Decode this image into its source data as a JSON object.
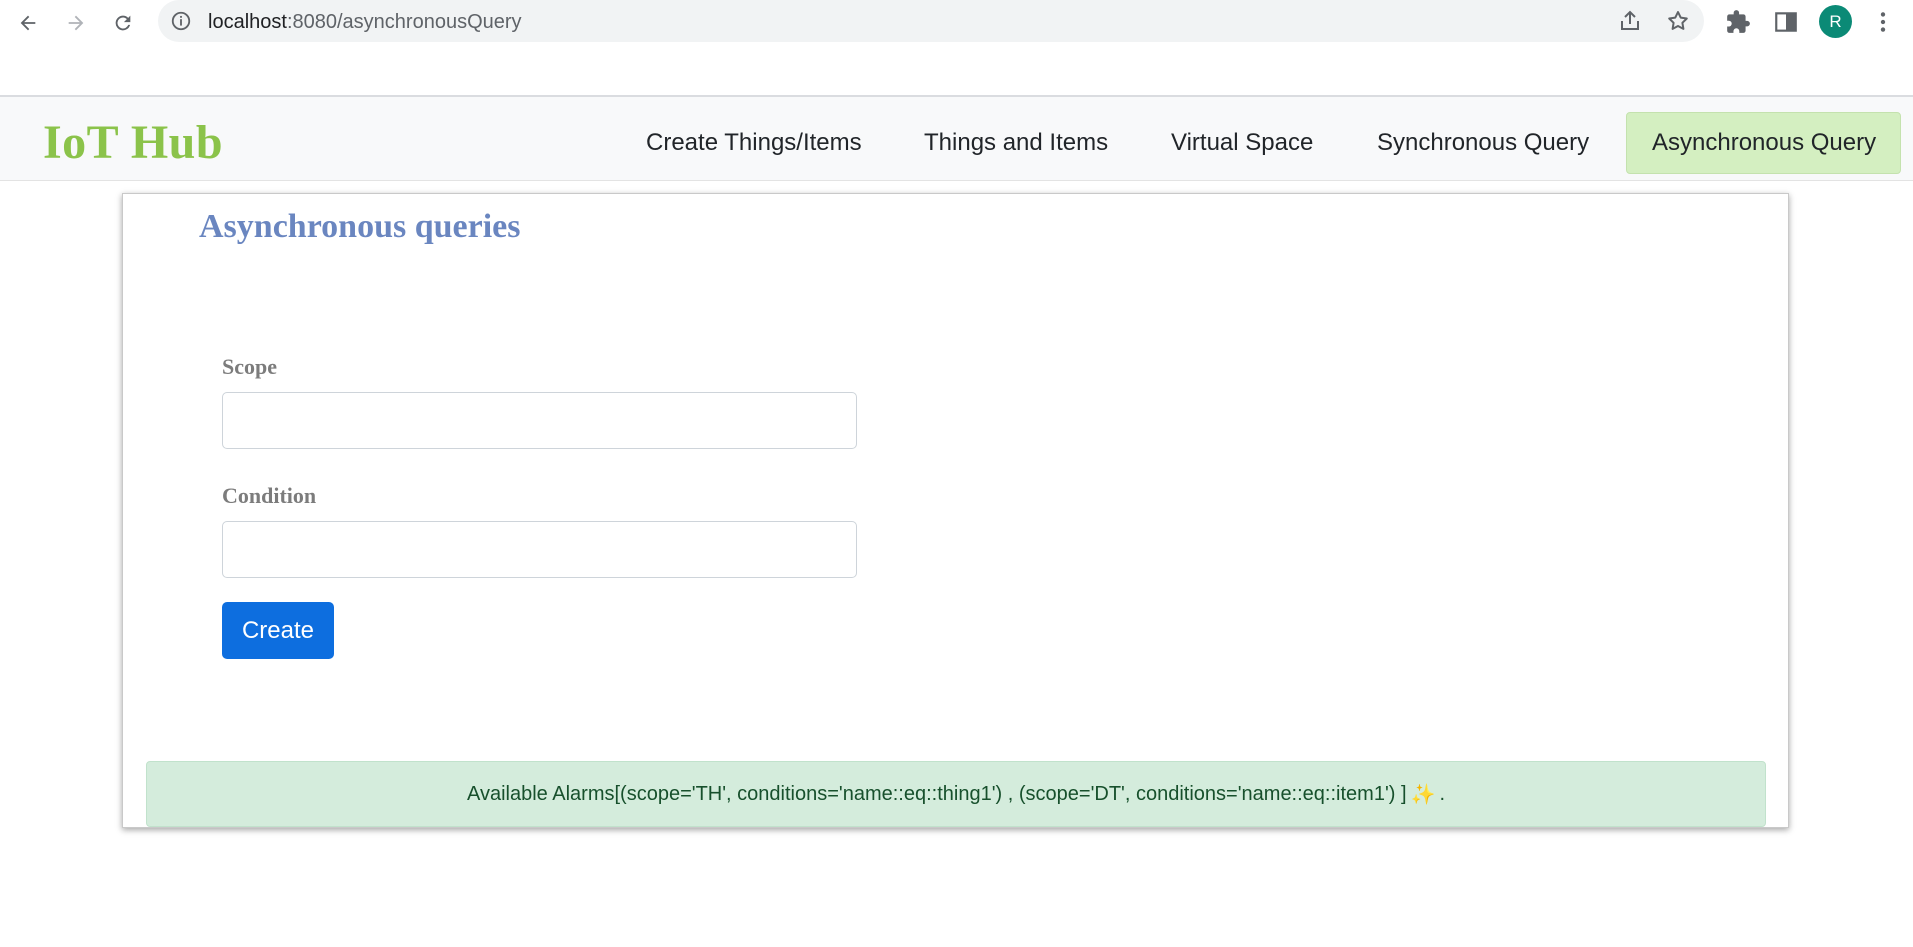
{
  "browser": {
    "url_host": "localhost",
    "url_path": ":8080/asynchronousQuery",
    "avatar_letter": "R"
  },
  "navbar": {
    "brand": "IoT Hub",
    "links": [
      {
        "label": "Create Things/Items",
        "active": false
      },
      {
        "label": "Things and Items",
        "active": false
      },
      {
        "label": "Virtual Space",
        "active": false
      },
      {
        "label": "Synchronous Query",
        "active": false
      },
      {
        "label": "Asynchronous Query",
        "active": true
      }
    ],
    "active_color": "#d4efc1",
    "brand_color": "#8bc34a"
  },
  "main": {
    "title": "Asynchronous queries",
    "title_color": "#6a86c0",
    "scope_label": "Scope",
    "scope_value": "",
    "condition_label": "Condition",
    "condition_value": "",
    "create_label": "Create",
    "button_color": "#0d6edf"
  },
  "alert": {
    "text": "Available Alarms[(scope='TH', conditions='name::eq::thing1') , (scope='DT', conditions='name::eq::item1') ]",
    "emoji": "✨",
    "suffix": ".",
    "color": "#d4ecdc"
  }
}
